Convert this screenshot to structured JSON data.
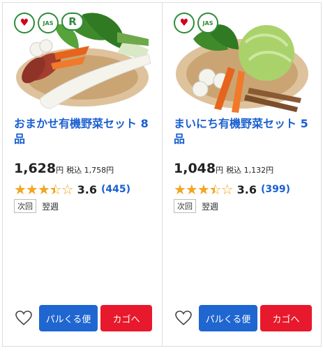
{
  "products": [
    {
      "title": "おまかせ有機野菜セット 8品",
      "price": "1,628",
      "yen": "円",
      "tax_label": "税込 1,758円",
      "rating": 3.5,
      "score": "3.6",
      "count": "(445)",
      "badges": [
        "コープフード",
        "有機JAS",
        "R"
      ],
      "delivery_tag": "次回",
      "delivery_when": "翌週",
      "pal_button": "パルくる便",
      "cart_button": "カゴへ",
      "colors": {
        "leaf": "#3f8a2a",
        "radish": "#f4f4ec",
        "carrot": "#e7641c",
        "sweetpotato": "#a33d2e",
        "basket": "#c89a5a"
      }
    },
    {
      "title": "まいにち有機野菜セット 5品",
      "price": "1,048",
      "yen": "円",
      "tax_label": "税込 1,132円",
      "rating": 3.5,
      "score": "3.6",
      "count": "(399)",
      "badges": [
        "コープフード",
        "有機JAS"
      ],
      "delivery_tag": "次回",
      "delivery_when": "翌週",
      "pal_button": "パルくる便",
      "cart_button": "カゴへ",
      "colors": {
        "leaf": "#3f8a2a",
        "cabbage": "#a9d36a",
        "carrot": "#e7641c",
        "burdock": "#8a5a35",
        "basket": "#c89a5a"
      }
    }
  ],
  "icons": {
    "favorite": "heart-outline-icon",
    "star": "star-icon"
  },
  "accent": {
    "link": "#1a5fd0",
    "pal": "#1f66d1",
    "cart": "#e8192c",
    "star": "#f2a51f"
  }
}
